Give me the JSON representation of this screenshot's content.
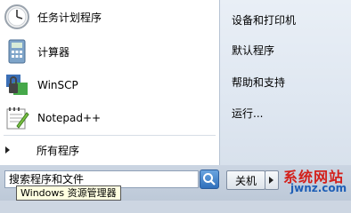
{
  "programs": [
    {
      "label": "任务计划程序",
      "icon": "clock-icon"
    },
    {
      "label": "计算器",
      "icon": "calculator-icon"
    },
    {
      "label": "WinSCP",
      "icon": "winscp-icon"
    },
    {
      "label": "Notepad++",
      "icon": "notepadpp-icon"
    }
  ],
  "all_programs": {
    "label": "所有程序"
  },
  "right": [
    "设备和打印机",
    "默认程序",
    "帮助和支持",
    "运行..."
  ],
  "search": {
    "value": "搜索程序和文件"
  },
  "shutdown": {
    "label": "关机"
  },
  "tooltip": "Windows 资源管理器",
  "watermark": {
    "top": "系统网站",
    "bottom": "jwnz.com"
  },
  "colors": {
    "accent": "#2f6fbb",
    "watermark_red": "#d3201b",
    "watermark_blue": "#1f5fb6"
  }
}
